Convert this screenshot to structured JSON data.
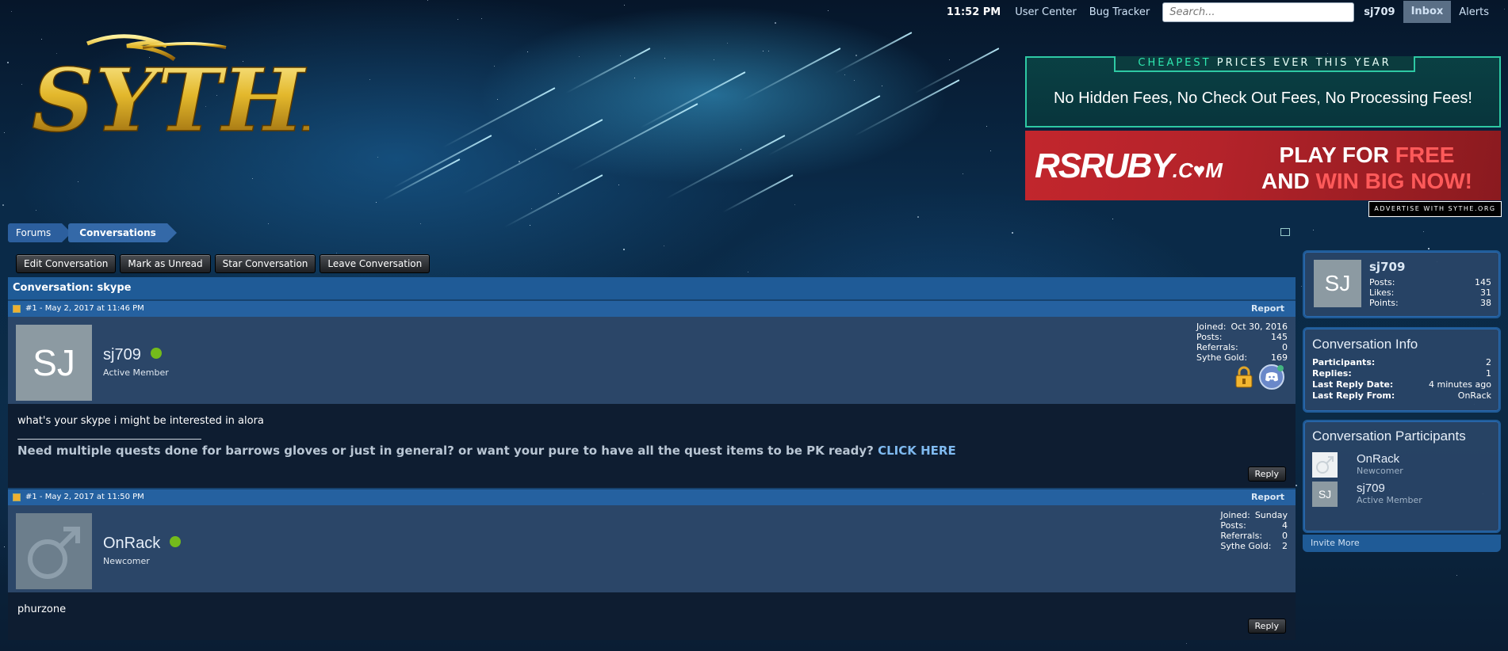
{
  "topnav": {
    "time": "11:52 PM",
    "user_center": "User Center",
    "bug_tracker": "Bug Tracker",
    "search_placeholder": "Search...",
    "username": "sj709",
    "inbox": "Inbox",
    "alerts": "Alerts"
  },
  "logo": {
    "text": "SYTHE"
  },
  "ads": {
    "ad1": {
      "tab_highlight": "CHEAPEST",
      "tab_rest": " PRICES EVER THIS YEAR",
      "main": "No Hidden Fees, No Check Out Fees, No Processing Fees!"
    },
    "ad2": {
      "brand_a": "RSRUBY",
      "brand_b": ".C♥M",
      "cta_line1_a": "PLAY FOR ",
      "cta_line1_b": "FREE",
      "cta_line2_a": "AND ",
      "cta_line2_b": "WIN BIG NOW!"
    },
    "advertise": "ADVERTISE WITH SYTHE.ORG"
  },
  "breadcrumb": {
    "forums": "Forums",
    "current": "Conversations"
  },
  "actions": {
    "edit": "Edit Conversation",
    "unread": "Mark as Unread",
    "star": "Star Conversation",
    "leave": "Leave Conversation"
  },
  "conversation": {
    "title": "Conversation: skype",
    "messages": [
      {
        "header": "#1 - May 2, 2017 at 11:46 PM",
        "report": "Report",
        "avatar": "SJ",
        "username": "sj709",
        "user_title": "Active Member",
        "stats": [
          {
            "k": "Joined:",
            "v": "Oct 30, 2016"
          },
          {
            "k": "Posts:",
            "v": "145"
          },
          {
            "k": "Referrals:",
            "v": "0"
          },
          {
            "k": "Sythe Gold:",
            "v": "169"
          }
        ],
        "body": "what's your skype i might be interested in alora",
        "signature": "Need multiple quests done for barrows gloves or just in general? or want your pure to have all the quest items to be PK ready? ",
        "signature_link": "CLICK HERE",
        "reply": "Reply"
      },
      {
        "header": "#1 - May 2, 2017 at 11:50 PM",
        "report": "Report",
        "username": "OnRack",
        "user_title": "Newcomer",
        "stats": [
          {
            "k": "Joined:",
            "v": "Sunday"
          },
          {
            "k": "Posts:",
            "v": "4"
          },
          {
            "k": "Referrals:",
            "v": "0"
          },
          {
            "k": "Sythe Gold:",
            "v": "2"
          }
        ],
        "body": "phurzone",
        "reply": "Reply"
      }
    ]
  },
  "sidebar": {
    "visitor": {
      "avatar": "SJ",
      "name": "sj709",
      "stats": [
        {
          "k": "Posts:",
          "v": "145"
        },
        {
          "k": "Likes:",
          "v": "31"
        },
        {
          "k": "Points:",
          "v": "38"
        }
      ]
    },
    "info": {
      "title": "Conversation Info",
      "rows": [
        {
          "k": "Participants:",
          "v": "2"
        },
        {
          "k": "Replies:",
          "v": "1"
        },
        {
          "k": "Last Reply Date:",
          "v": "4 minutes ago"
        },
        {
          "k": "Last Reply From:",
          "v": "OnRack"
        }
      ]
    },
    "participants": {
      "title": "Conversation Participants",
      "items": [
        {
          "name": "OnRack",
          "title": "Newcomer"
        },
        {
          "avatar": "SJ",
          "name": "sj709",
          "title": "Active Member"
        }
      ],
      "invite": "Invite More"
    }
  }
}
